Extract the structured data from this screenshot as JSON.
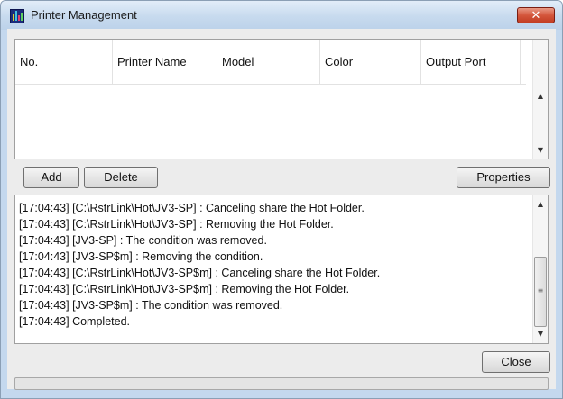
{
  "window": {
    "title": "Printer Management",
    "close_glyph": "✕"
  },
  "printer_table": {
    "columns": [
      "No.",
      "Printer Name",
      "Model",
      "Color",
      "Output Port"
    ],
    "rows": []
  },
  "scroll_icons": {
    "up": "▲",
    "down": "▼",
    "grip": "≡"
  },
  "buttons": {
    "add": "Add",
    "delete": "Delete",
    "properties": "Properties",
    "close": "Close"
  },
  "log": {
    "lines": [
      "[17:04:43] [C:\\RstrLink\\Hot\\JV3-SP] : Canceling share the Hot Folder.",
      "[17:04:43] [C:\\RstrLink\\Hot\\JV3-SP] : Removing the Hot Folder.",
      "[17:04:43] [JV3-SP] : The condition was removed.",
      "[17:04:43] [JV3-SP$m] : Removing the condition.",
      "[17:04:43] [C:\\RstrLink\\Hot\\JV3-SP$m] : Canceling share the Hot Folder.",
      "[17:04:43] [C:\\RstrLink\\Hot\\JV3-SP$m] : Removing the Hot Folder.",
      "[17:04:43] [JV3-SP$m] : The condition was removed.",
      "[17:04:43] Completed."
    ]
  }
}
